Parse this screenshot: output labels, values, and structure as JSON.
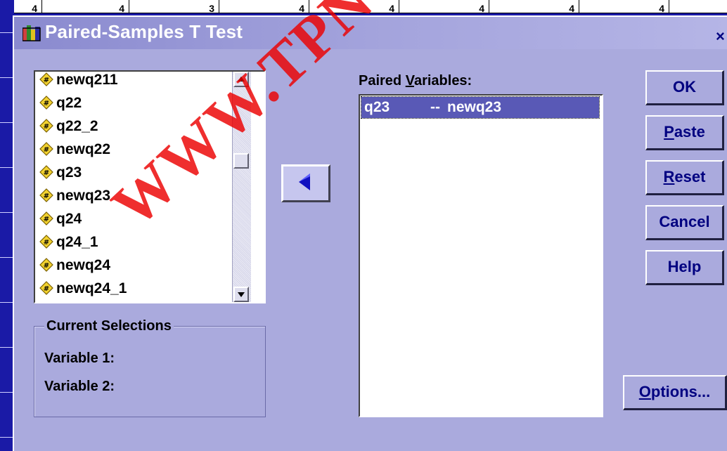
{
  "background_sheet": {
    "cells": [
      "4",
      "4",
      "3",
      "4",
      "4",
      "4",
      "4",
      "4"
    ]
  },
  "dialog": {
    "title": "Paired-Samples T Test",
    "close_label": "×"
  },
  "variable_list": {
    "items": [
      "newq211",
      "q22",
      "q22_2",
      "newq22",
      "q23",
      "newq23",
      "q24",
      "q24_1",
      "newq24",
      "newq24_1"
    ],
    "item_icon": "numeric-variable-icon"
  },
  "move_button": {
    "icon": "left-arrow-icon"
  },
  "paired_variables": {
    "label_before": "Paired ",
    "label_accel": "V",
    "label_after": "ariables:",
    "rows": [
      {
        "variable1": "q23",
        "separator": "--",
        "variable2": "newq23",
        "selected": true
      }
    ]
  },
  "current_selections": {
    "title": "Current Selections",
    "variable1_label": "Variable 1:",
    "variable2_label": "Variable 2:"
  },
  "buttons": {
    "ok": "OK",
    "paste_accel": "P",
    "paste_rest": "aste",
    "reset_accel": "R",
    "reset_rest": "eset",
    "cancel": "Cancel",
    "help": "Help",
    "options_accel": "O",
    "options_rest": "ptions..."
  },
  "watermark": "WWW.TPNUEB.COM",
  "colors": {
    "dialog_bg": "#aaaadd",
    "title_text": "#ffffff",
    "selection_bg": "#5959b6",
    "button_text": "#000080",
    "watermark": "#eb0000"
  }
}
